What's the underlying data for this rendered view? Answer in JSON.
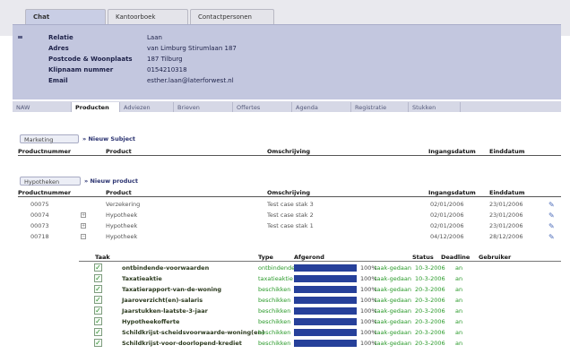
{
  "top_tabs": [
    {
      "label": "Chat",
      "active": true
    },
    {
      "label": "Kantoorboek",
      "active": false
    },
    {
      "label": "Contactpersonen",
      "active": false
    }
  ],
  "relation": {
    "fields": [
      {
        "label": "Relatie",
        "value": "Laan"
      },
      {
        "label": "Adres",
        "value": "van Limburg Stirumlaan 187"
      },
      {
        "label": "Postcode & Woonplaats",
        "value": "187 Tilburg"
      },
      {
        "label": "Klipnaam nummer",
        "value": "0154210318"
      },
      {
        "label": "Email",
        "value": "esther.laan@laterforwest.nl"
      }
    ]
  },
  "sub_tabs": [
    {
      "label": "NAW",
      "active": false
    },
    {
      "label": "Producten",
      "active": true
    },
    {
      "label": "Adviezen",
      "active": false
    },
    {
      "label": "Brieven",
      "active": false
    },
    {
      "label": "Offertes",
      "active": false
    },
    {
      "label": "Agenda",
      "active": false
    },
    {
      "label": "Registratie",
      "active": false
    },
    {
      "label": "Stukken",
      "active": false
    }
  ],
  "subject_section": {
    "button": "Marketing",
    "link": "» Nieuw Subject",
    "columns": [
      "Productnummer",
      "Product",
      "Omschrijving",
      "Ingangsdatum",
      "Einddatum"
    ]
  },
  "product_section": {
    "button": "Hypotheken",
    "link": "» Nieuw product",
    "columns": [
      "Productnummer",
      "Product",
      "Omschrijving",
      "Ingangsdatum",
      "Einddatum"
    ],
    "rows": [
      {
        "nr": "00075",
        "product": "Verzekering",
        "desc": "Test case stak 3",
        "start": "02/01/2006",
        "end": "23/01/2006",
        "expander": ""
      },
      {
        "nr": "00074",
        "product": "Hypotheek",
        "desc": "Test case stak 2",
        "start": "02/01/2006",
        "end": "23/01/2006",
        "expander": "+"
      },
      {
        "nr": "00073",
        "product": "Hypotheek",
        "desc": "Test case stak 1",
        "start": "02/01/2006",
        "end": "23/01/2006",
        "expander": "+"
      },
      {
        "nr": "00718",
        "product": "Hypotheek",
        "desc": "",
        "start": "04/12/2006",
        "end": "28/12/2006",
        "expander": "−"
      }
    ]
  },
  "task_section": {
    "columns": [
      "Taak",
      "Type",
      "Afgerond",
      "Status",
      "Deadline",
      "Gebruiker"
    ],
    "rows": [
      {
        "name": "ontbindende-voorwaarden",
        "type": "ontbindende-v",
        "progress": 1.0,
        "pct": "100%",
        "status": "taak-gedaan",
        "deadline": "10-3-2006",
        "user": "an"
      },
      {
        "name": "Taxatieaktie",
        "type": "taxatieaktie",
        "progress": 1.0,
        "pct": "100%",
        "status": "taak-gedaan",
        "deadline": "10-3-2006",
        "user": "an"
      },
      {
        "name": "Taxatierapport-van-de-woning",
        "type": "beschikken",
        "progress": 1.0,
        "pct": "100%",
        "status": "taak-gedaan",
        "deadline": "20-3-2006",
        "user": "an"
      },
      {
        "name": "Jaaroverzicht(en)-salaris",
        "type": "beschikken",
        "progress": 1.0,
        "pct": "100%",
        "status": "taak-gedaan",
        "deadline": "20-3-2006",
        "user": "an"
      },
      {
        "name": "Jaarstukken-laatste-3-jaar",
        "type": "beschikken",
        "progress": 1.0,
        "pct": "100%",
        "status": "taak-gedaan",
        "deadline": "20-3-2006",
        "user": "an"
      },
      {
        "name": "Hypotheekofferte",
        "type": "beschikken",
        "progress": 1.0,
        "pct": "100%",
        "status": "taak-gedaan",
        "deadline": "20-3-2006",
        "user": "an"
      },
      {
        "name": "Schildkrijst-scheidsvoorwaarde-woning(en)",
        "type": "beschikken",
        "progress": 1.0,
        "pct": "100%",
        "status": "taak-gedaan",
        "deadline": "20-3-2006",
        "user": "an"
      },
      {
        "name": "Schildkrijst-voor-doorlopend-krediet",
        "type": "beschikken",
        "progress": 1.0,
        "pct": "100%",
        "status": "taak-gedaan",
        "deadline": "20-3-2006",
        "user": "an"
      }
    ]
  },
  "colors": {
    "accent": "#26409a",
    "panel": "#c3c7df",
    "status_green": "#2a9a2a"
  }
}
